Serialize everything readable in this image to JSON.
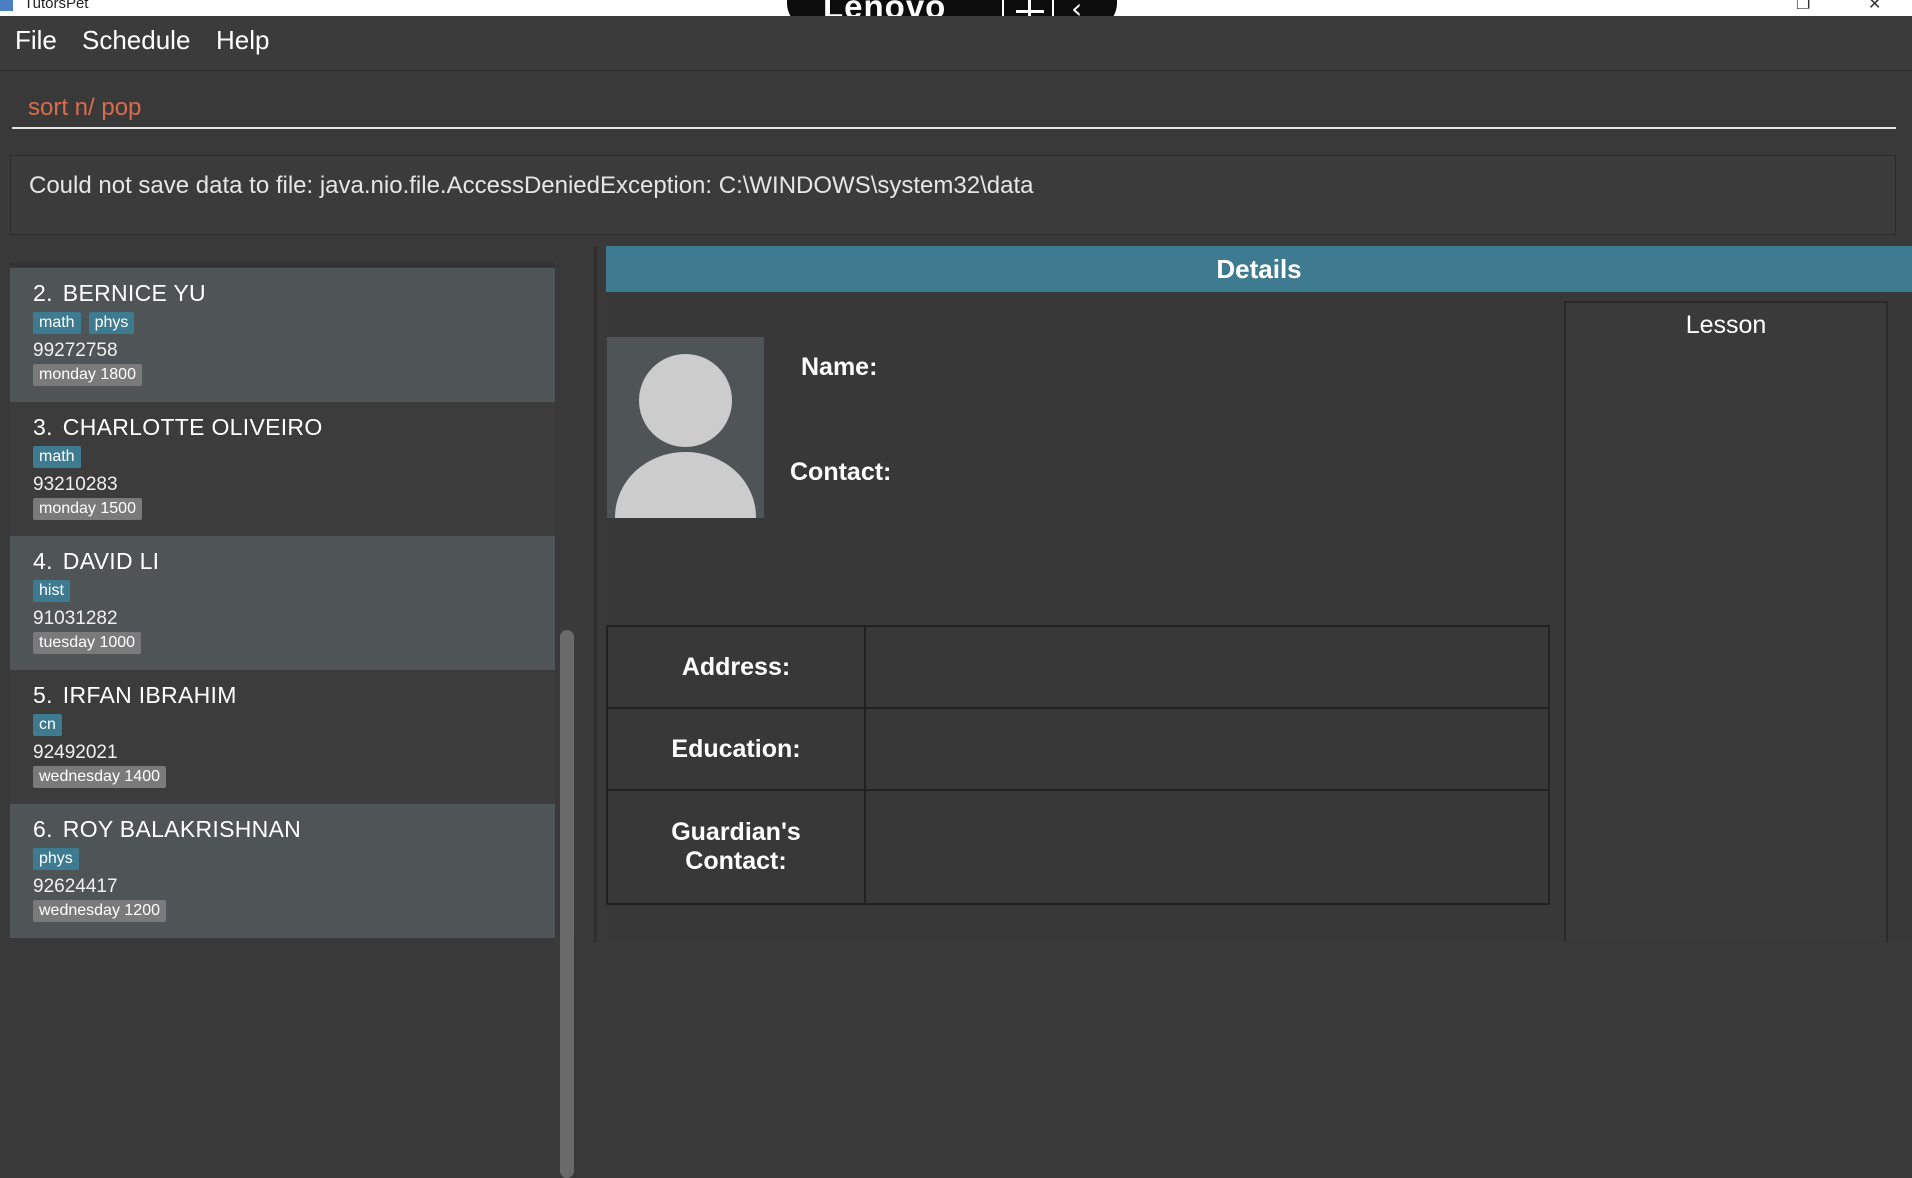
{
  "window": {
    "title": "TutorsPet",
    "min_icon": "restore-icon",
    "close_icon": "close-icon",
    "overlay": {
      "brand": "Lenovo",
      "network_icon": "network-icon",
      "back_icon": "chevron-left-icon"
    }
  },
  "menu": {
    "items": [
      {
        "label": "File"
      },
      {
        "label": "Schedule"
      },
      {
        "label": "Help"
      }
    ]
  },
  "command": {
    "value": "sort n/ pop"
  },
  "result": {
    "message": "Could not save data to file: java.nio.file.AccessDeniedException: C:\\WINDOWS\\system32\\data"
  },
  "persons": [
    {
      "index": "2.",
      "name": "BERNICE YU",
      "tags": [
        "math",
        "phys"
      ],
      "phone": "99272758",
      "lesson": "monday 1800"
    },
    {
      "index": "3.",
      "name": "CHARLOTTE OLIVEIRO",
      "tags": [
        "math"
      ],
      "phone": "93210283",
      "lesson": "monday 1500"
    },
    {
      "index": "4.",
      "name": "DAVID LI",
      "tags": [
        "hist"
      ],
      "phone": "91031282",
      "lesson": "tuesday 1000"
    },
    {
      "index": "5.",
      "name": "IRFAN IBRAHIM",
      "tags": [
        "cn"
      ],
      "phone": "92492021",
      "lesson": "wednesday 1400"
    },
    {
      "index": "6.",
      "name": "ROY BALAKRISHNAN",
      "tags": [
        "phys"
      ],
      "phone": "92624417",
      "lesson": "wednesday 1200"
    }
  ],
  "details": {
    "title": "Details",
    "name_label": "Name:",
    "contact_label": "Contact:",
    "address_label": "Address:",
    "education_label": "Education:",
    "guardian_label_1": "Guardian's",
    "guardian_label_2": "Contact:",
    "lesson_title": "Lesson"
  },
  "colors": {
    "accent": "#3e7b91",
    "background": "#393939",
    "card_alt": "#4f5456",
    "command_text": "#d86c4c",
    "lesson_tag": "#7a7a7a"
  }
}
